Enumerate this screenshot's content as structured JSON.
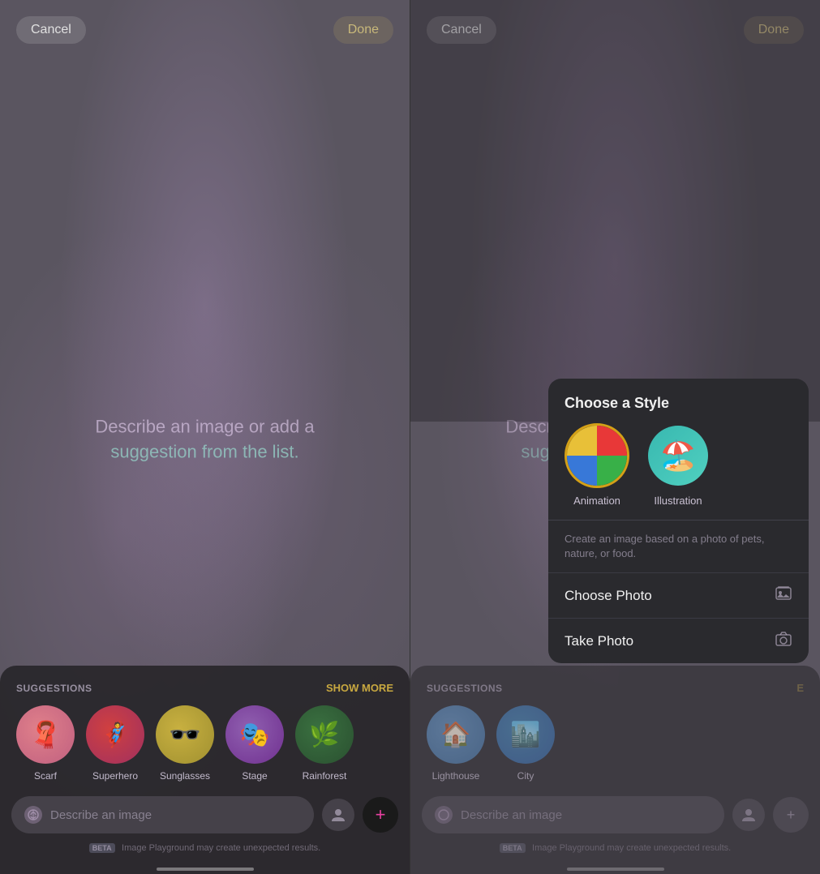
{
  "left_panel": {
    "cancel_label": "Cancel",
    "done_label": "Done",
    "center_text_part1": "Describe an image or add a",
    "center_text_part2": "suggestion from the list.",
    "suggestions_label": "SUGGESTIONS",
    "show_more_label": "SHOW MORE",
    "suggestions": [
      {
        "id": "scarf",
        "label": "Scarf",
        "emoji": "🧣",
        "color_class": "sug-scarf"
      },
      {
        "id": "superhero",
        "label": "Superhero",
        "emoji": "🦸",
        "color_class": "sug-superhero"
      },
      {
        "id": "sunglasses",
        "label": "Sunglasses",
        "emoji": "🕶️",
        "color_class": "sug-sunglasses"
      },
      {
        "id": "stage",
        "label": "Stage",
        "emoji": "🎭",
        "color_class": "sug-stage"
      },
      {
        "id": "rainforest",
        "label": "Rainforest",
        "emoji": "🌿",
        "color_class": "sug-rainforest"
      }
    ],
    "input_placeholder": "Describe an image",
    "beta_text": "Image Playground may create unexpected results."
  },
  "right_panel": {
    "cancel_label": "Cancel",
    "done_label": "Done",
    "center_text_part1": "Describe an image or add a",
    "center_text_part2": "suggestion from the list.",
    "suggestions_label": "SUGGESTIONS",
    "suggestions": [
      {
        "id": "lighthouse",
        "label": "Lighthouse",
        "emoji": "🏠",
        "color_class": "sug-lighthouse"
      },
      {
        "id": "city",
        "label": "City",
        "emoji": "🏙️",
        "color_class": "sug-city"
      }
    ],
    "input_placeholder": "Describe an image",
    "beta_text": "Image Playground may create unexpected results."
  },
  "style_popup": {
    "title": "Choose a Style",
    "styles": [
      {
        "id": "animation",
        "label": "Animation",
        "selected": true
      },
      {
        "id": "illustration",
        "label": "Illustration",
        "selected": false
      }
    ],
    "description": "Create an image based on a photo of pets, nature, or food.",
    "choose_photo_label": "Choose Photo",
    "take_photo_label": "Take Photo"
  },
  "icons": {
    "plus": "+",
    "person": "👤",
    "camera": "📷",
    "photo_library": "🖼"
  }
}
